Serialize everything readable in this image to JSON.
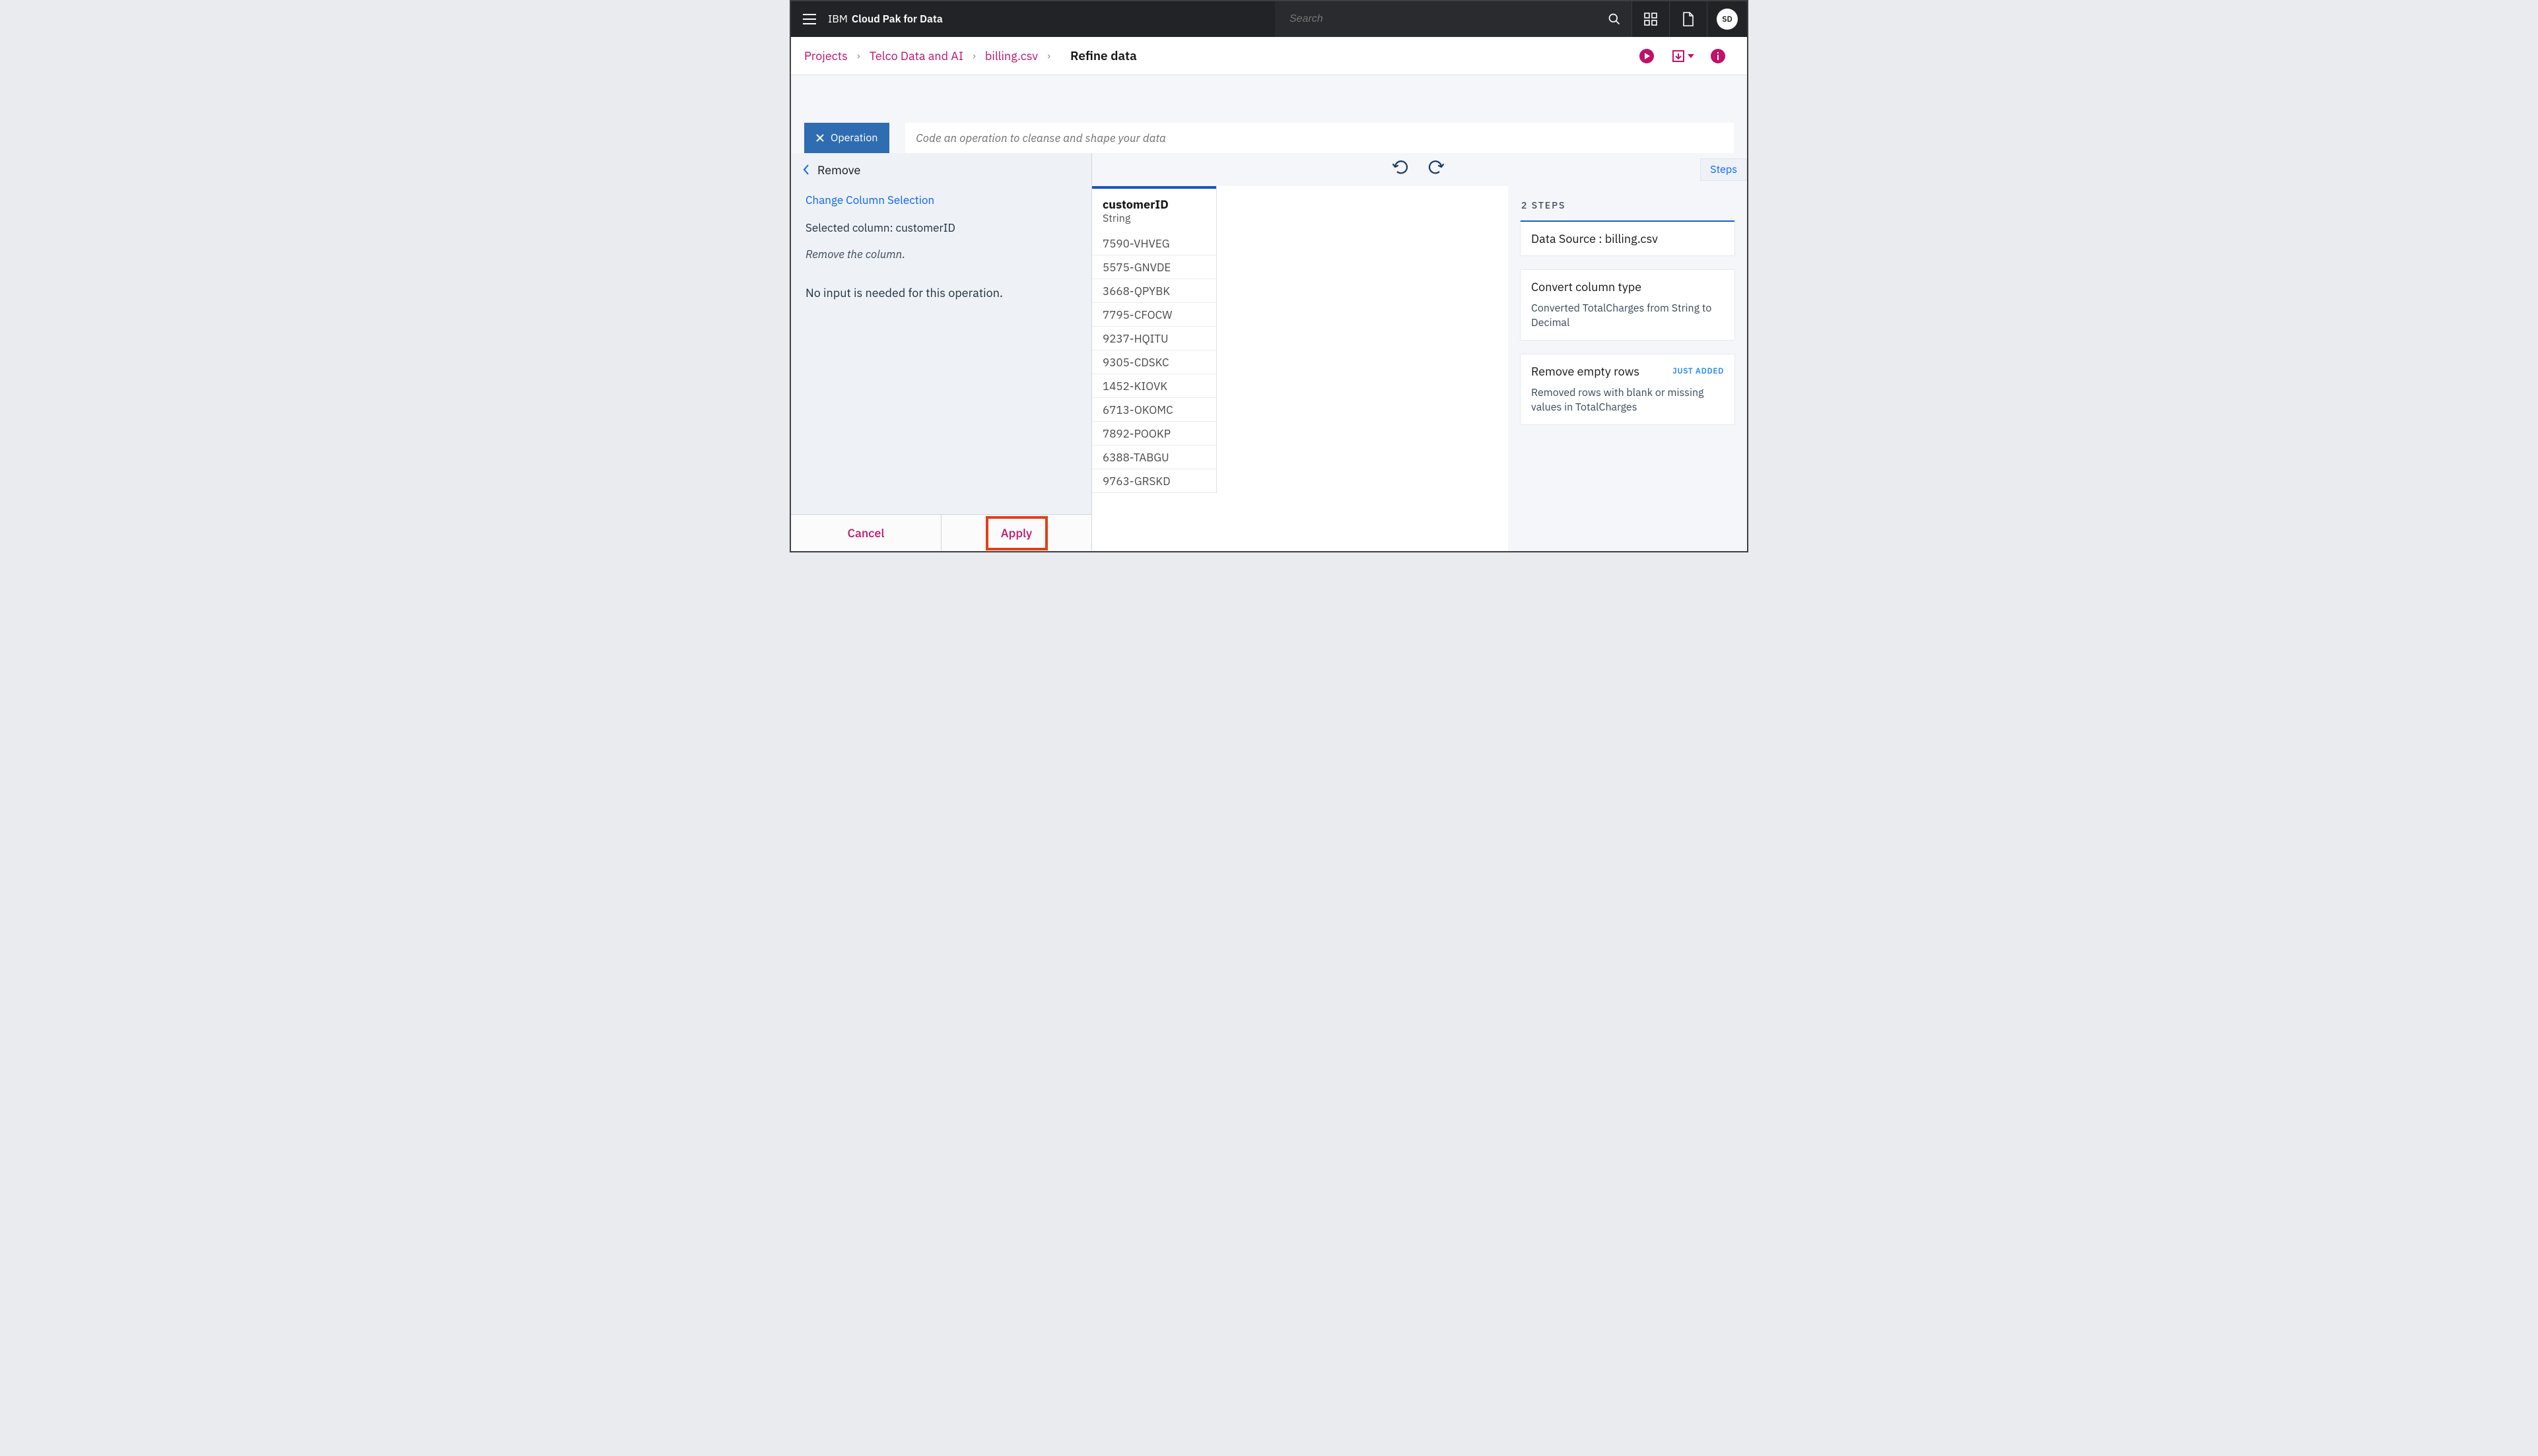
{
  "header": {
    "brand_light": "IBM",
    "brand_bold": "Cloud Pak for Data",
    "search_placeholder": "Search",
    "avatar_initials": "SD"
  },
  "breadcrumb": {
    "projects": "Projects",
    "project_name": "Telco Data and AI",
    "file_name": "billing.csv",
    "current": "Refine data"
  },
  "operation_bar": {
    "chip_label": "Operation",
    "code_placeholder": "Code an operation to cleanse and shape your data"
  },
  "left_panel": {
    "title": "Remove",
    "change_link": "Change Column Selection",
    "selected_label": "Selected column: customerID",
    "description": "Remove the column.",
    "note": "No input is needed for this operation.",
    "cancel": "Cancel",
    "apply": "Apply"
  },
  "preview": {
    "column_name": "customerID",
    "column_type": "String",
    "rows": [
      "7590-VHVEG",
      "5575-GNVDE",
      "3668-QPYBK",
      "7795-CFOCW",
      "9237-HQITU",
      "9305-CDSKC",
      "1452-KIOVK",
      "6713-OKOMC",
      "7892-POOKP",
      "6388-TABGU",
      "9763-GRSKD"
    ]
  },
  "steps_button": "Steps",
  "steps": {
    "count_label": "2 STEPS",
    "data_source": "Data Source : billing.csv",
    "s1_title": "Convert column type",
    "s1_desc": "Converted TotalCharges from String to Decimal",
    "s2_title": "Remove empty rows",
    "s2_badge": "JUST ADDED",
    "s2_desc": "Removed rows with blank or missing values in TotalCharges"
  }
}
